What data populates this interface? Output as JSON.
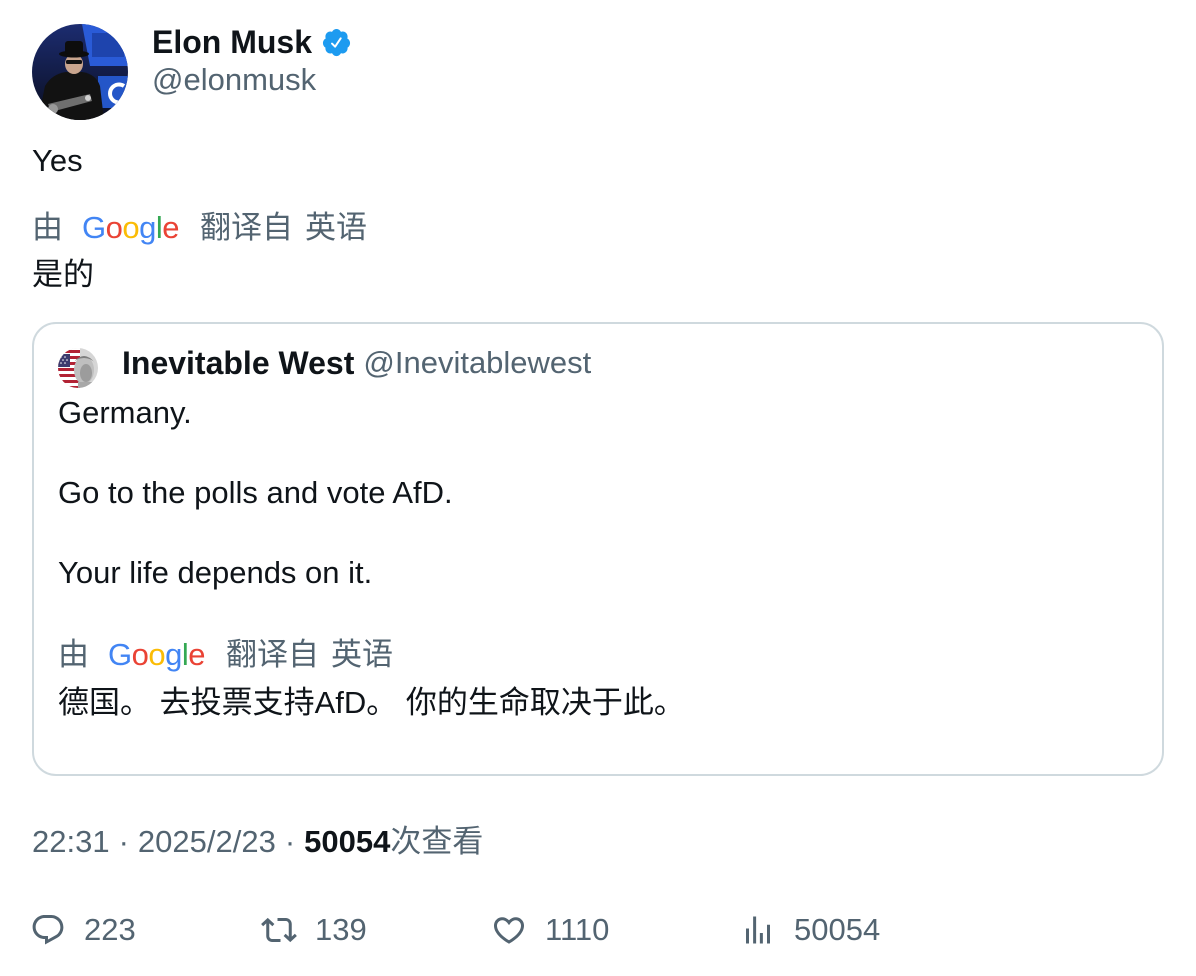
{
  "tweet": {
    "author": {
      "name": "Elon Musk",
      "handle": "@elonmusk",
      "verified": true
    },
    "text": "Yes",
    "translation": {
      "by": "由",
      "logo": "Google",
      "from": "翻译自",
      "language": "英语",
      "text": "是的"
    },
    "quote": {
      "author": {
        "name": "Inevitable West",
        "handle": "@Inevitablewest"
      },
      "paragraphs": [
        "Germany.",
        "Go to the polls and vote AfD.",
        "Your life depends on it."
      ],
      "translation": {
        "by": "由",
        "logo": "Google",
        "from": "翻译自",
        "language": "英语",
        "text": "德国。 去投票支持AfD。 你的生命取决于此。"
      }
    },
    "meta": {
      "time": "22:31",
      "separator": "·",
      "date": "2025/2/23",
      "views": "50054",
      "views_label": "次查看"
    },
    "actions": [
      {
        "icon": "reply-icon",
        "count": "223"
      },
      {
        "icon": "retweet-icon",
        "count": "139"
      },
      {
        "icon": "heart-icon",
        "count": "1110"
      },
      {
        "icon": "views-icon",
        "count": "50054"
      }
    ]
  },
  "colors": {
    "text": "#0f1419",
    "muted": "#536471",
    "border": "#cfd9de",
    "verified_badge": "#1d9bf0",
    "google_logo": [
      "#4285F4",
      "#EA4335",
      "#FBBC05",
      "#4285F4",
      "#34A853",
      "#EA4335"
    ]
  }
}
